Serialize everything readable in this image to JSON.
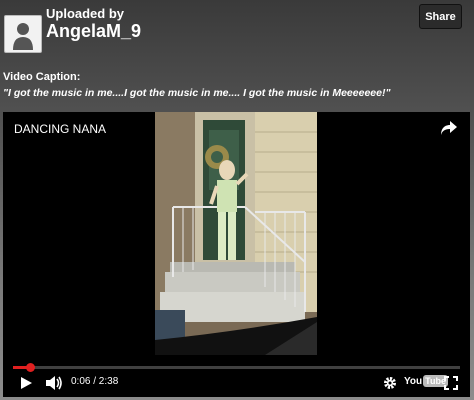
{
  "uploader": {
    "label": "Uploaded by",
    "username": "AngelaM_9",
    "avatar_icon": "user-silhouette-icon"
  },
  "header": {
    "share_label": "Share"
  },
  "caption": {
    "label": "Video Caption:",
    "text": "\"I got the music in me....I got the music in me.... I got the music in Meeeeeee!\""
  },
  "video": {
    "title": "DANCING NANA",
    "current_time": "0:06",
    "duration": "2:38",
    "time_display": "0:06 / 2:38",
    "progress_fraction": 0.038,
    "logo_you": "You",
    "logo_tube": "Tube",
    "progress_color": "#e02020"
  }
}
